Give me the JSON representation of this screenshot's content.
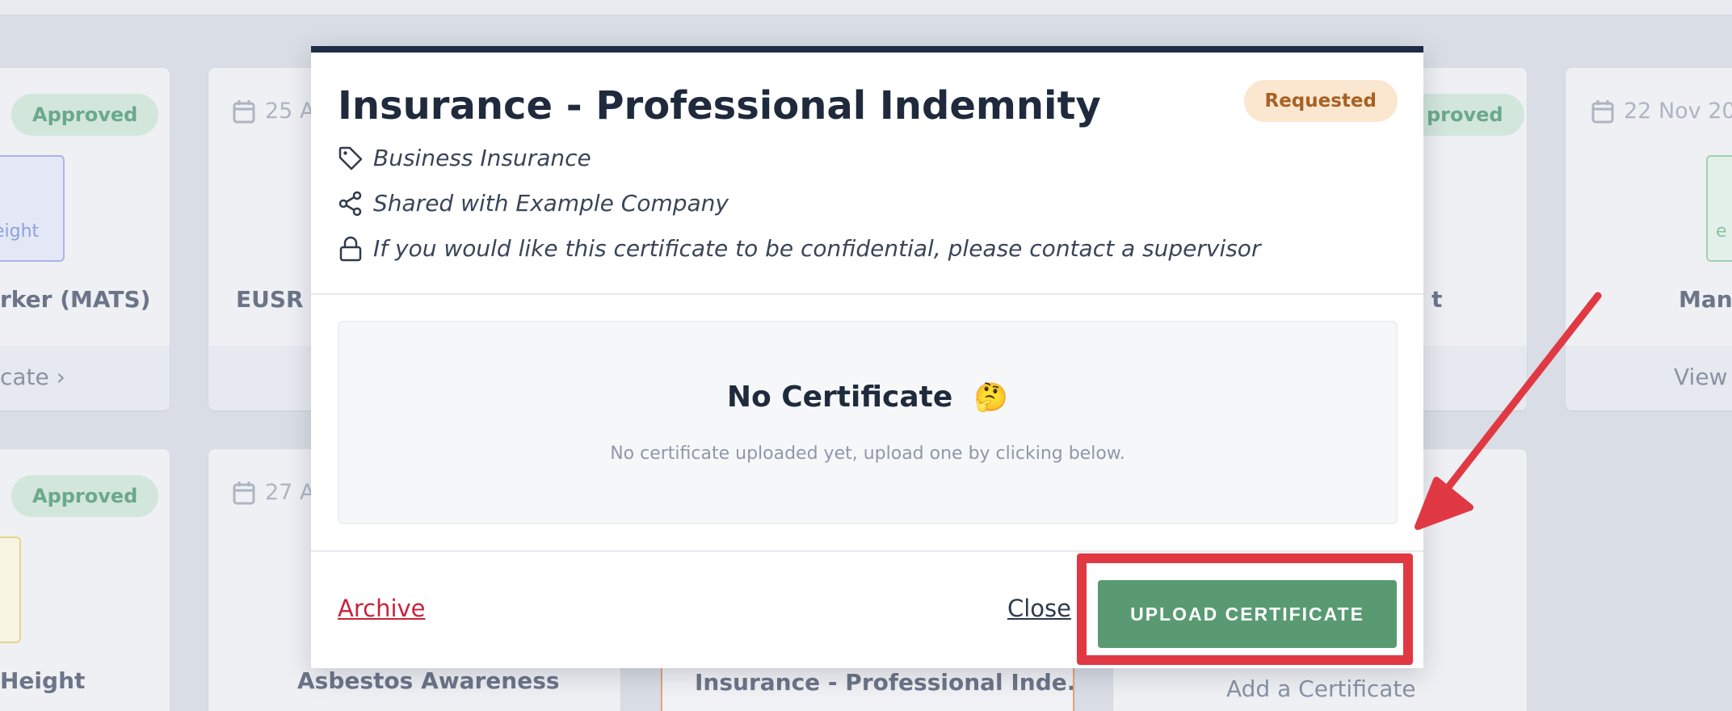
{
  "background": {
    "cards": [
      {
        "badge": "Approved",
        "thumb_text": "eight",
        "title": "rker (MATS)",
        "link": "cate"
      },
      {
        "date": "25 A",
        "title": "EUSR T"
      },
      {
        "badge": "proved",
        "title": "t"
      },
      {
        "date": "22 Nov 20",
        "thumb_text": "e",
        "title": "Manu",
        "link": "View"
      },
      {
        "badge": "Approved",
        "title": "Height"
      },
      {
        "date": "27 A",
        "title": "Asbestos Awareness"
      },
      {
        "title": "Insurance - Professional Inde..."
      },
      {
        "title": "Add a Certificate"
      }
    ]
  },
  "modal": {
    "title": "Insurance - Professional Indemnity",
    "status": "Requested",
    "category": "Business Insurance",
    "shared_with": "Shared with Example Company",
    "confidential_note": "If you would like this certificate to be confidential, please contact a supervisor",
    "empty_title": "No Certificate",
    "empty_emoji": "🤔",
    "empty_subtitle": "No certificate uploaded yet, upload one by clicking below.",
    "archive_label": "Archive",
    "close_label": "Close",
    "upload_label": "UPLOAD CERTIFICATE"
  },
  "colors": {
    "accent_green": "#5a9a73",
    "danger_red": "#c8243b",
    "highlight_red": "#e03943",
    "modal_border": "#1e2c45"
  }
}
